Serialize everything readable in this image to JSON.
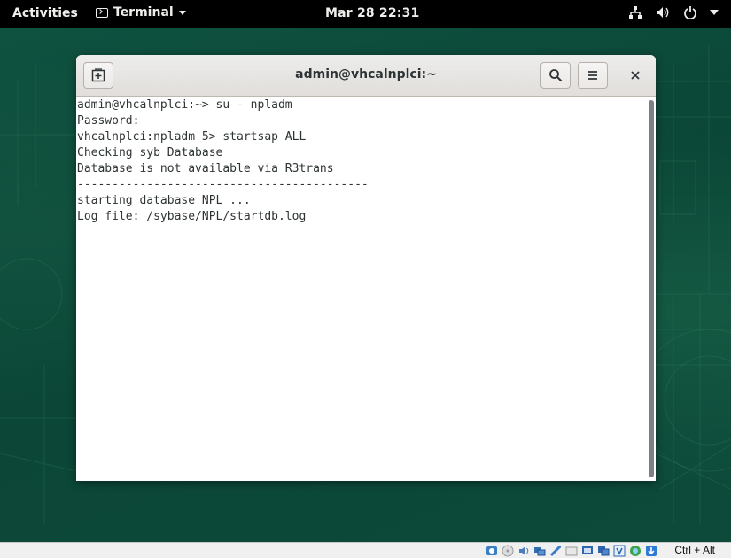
{
  "topbar": {
    "activities": "Activities",
    "app_menu": "Terminal",
    "clock": "Mar 28  22:31",
    "tray_icons": [
      "network-icon",
      "volume-icon",
      "power-icon",
      "system-menu-arrow-icon"
    ]
  },
  "window": {
    "title": "admin@vhcalnplci:~",
    "buttons": [
      "new-tab-icon",
      "search-icon",
      "hamburger-menu-icon",
      "close-icon"
    ]
  },
  "terminal": {
    "lines": [
      "admin@vhcalnplci:~> su - npladm",
      "Password:",
      "vhcalnplci:npladm 5> startsap ALL",
      "Checking syb Database",
      "Database is not available via R3trans",
      "------------------------------------------",
      "starting database NPL ...",
      "Log file: /sybase/NPL/startdb.log"
    ]
  },
  "statusbar": {
    "host_key": "Ctrl + Alt",
    "icons": [
      "hdd-icon",
      "optical-icon",
      "audio-icon",
      "network-adapter-icon",
      "usb-icon",
      "shared-folder-icon",
      "display-icon",
      "video-capture-icon",
      "cpu-icon",
      "mouse-integration-icon",
      "keyboard-capture-icon"
    ]
  },
  "colors": {
    "topbar_bg": "#000000",
    "desktop_bg": "#0c4a3a",
    "header_bg": "#e8e6e3",
    "terminal_fg": "#2e3436",
    "scroll_thumb": "#7e8087"
  }
}
